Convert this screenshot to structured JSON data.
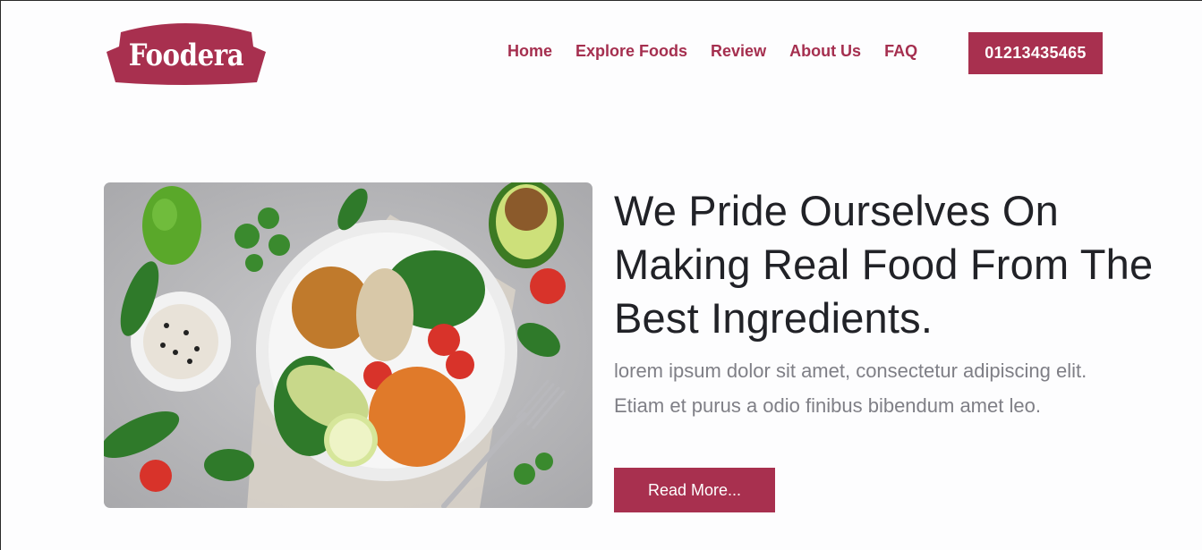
{
  "brand": {
    "name": "Foodera",
    "color": "#a8304f"
  },
  "nav": {
    "items": [
      {
        "label": "Home"
      },
      {
        "label": "Explore Foods"
      },
      {
        "label": "Review"
      },
      {
        "label": "About Us"
      },
      {
        "label": "FAQ"
      }
    ],
    "phone_label": "01213435465"
  },
  "hero": {
    "title": "We Pride Ourselves On Making Real Food From The Best Ingredients.",
    "description": "lorem ipsum dolor sit amet, consectetur adipiscing elit. Etiam et purus a odio finibus bibendum amet leo.",
    "button_label": "Read More...",
    "image_subject": "salad-bowl-photo"
  }
}
